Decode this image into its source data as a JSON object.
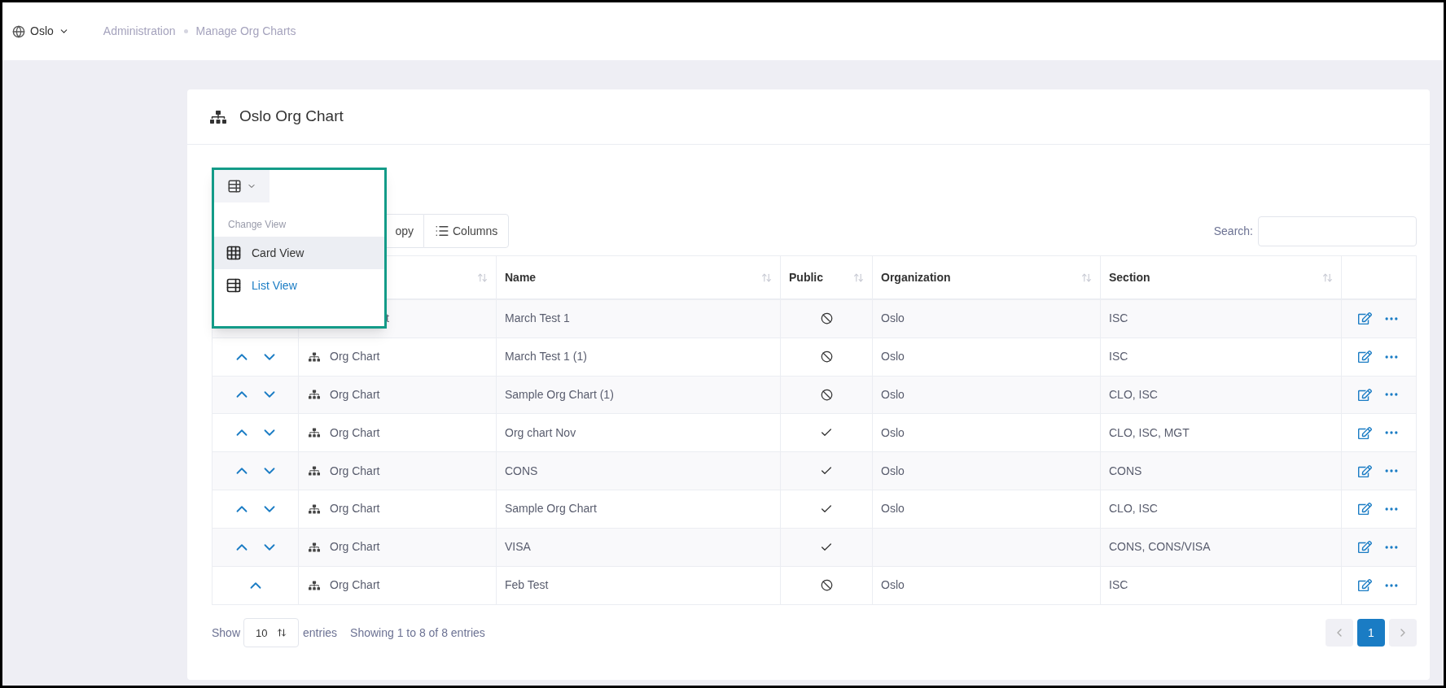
{
  "topbar": {
    "location": "Oslo",
    "breadcrumbs": [
      "Administration",
      "Manage Org Charts"
    ]
  },
  "card": {
    "title": "Oslo Org Chart"
  },
  "view_menu": {
    "header": "Change View",
    "items": [
      {
        "label": "Card View",
        "kind": "grid",
        "selected": false,
        "hovered": true
      },
      {
        "label": "List View",
        "kind": "list",
        "selected": true,
        "hovered": false
      }
    ]
  },
  "toolbar": {
    "buttons": [
      {
        "label": "opy",
        "kind": "plain"
      },
      {
        "label": "Columns",
        "kind": "columns"
      }
    ],
    "search": {
      "label": "Search:"
    }
  },
  "table": {
    "columns": [
      {},
      {
        "sortable": true
      },
      {
        "label": "Name",
        "sortable": true
      },
      {
        "label": "Public",
        "sortable": true
      },
      {
        "label": "Organization",
        "sortable": true
      },
      {
        "label": "Section",
        "sortable": true
      },
      {}
    ],
    "rows": [
      {
        "icon": false,
        "type": "t",
        "name": "March Test 1",
        "public": false,
        "organization": "Oslo",
        "section": "ISC"
      },
      {
        "up": true,
        "down": true,
        "icon": true,
        "type": "Org Chart",
        "name": "March Test 1 (1)",
        "public": false,
        "organization": "Oslo",
        "section": "ISC"
      },
      {
        "up": true,
        "down": true,
        "icon": true,
        "type": "Org Chart",
        "name": "Sample Org Chart (1)",
        "public": false,
        "organization": "Oslo",
        "section": "CLO, ISC"
      },
      {
        "up": true,
        "down": true,
        "icon": true,
        "type": "Org Chart",
        "name": "Org chart Nov",
        "public": true,
        "organization": "Oslo",
        "section": "CLO, ISC, MGT"
      },
      {
        "up": true,
        "down": true,
        "icon": true,
        "type": "Org Chart",
        "name": "CONS",
        "public": true,
        "organization": "Oslo",
        "section": "CONS"
      },
      {
        "up": true,
        "down": true,
        "icon": true,
        "type": "Org Chart",
        "name": "Sample Org Chart",
        "public": true,
        "organization": "Oslo",
        "section": "CLO, ISC"
      },
      {
        "up": true,
        "down": true,
        "icon": true,
        "type": "Org Chart",
        "name": "VISA",
        "public": true,
        "section": "CONS, CONS/VISA"
      },
      {
        "up": true,
        "down": false,
        "icon": true,
        "type": "Org Chart",
        "name": "Feb Test",
        "public": false,
        "organization": "Oslo",
        "section": "ISC"
      }
    ]
  },
  "footer": {
    "show_label": "Show",
    "page_size": "10",
    "entries_label": "entries",
    "info": "Showing 1 to 8 of 8 entries",
    "pages": [
      {
        "label": "1",
        "selected": true
      }
    ]
  }
}
